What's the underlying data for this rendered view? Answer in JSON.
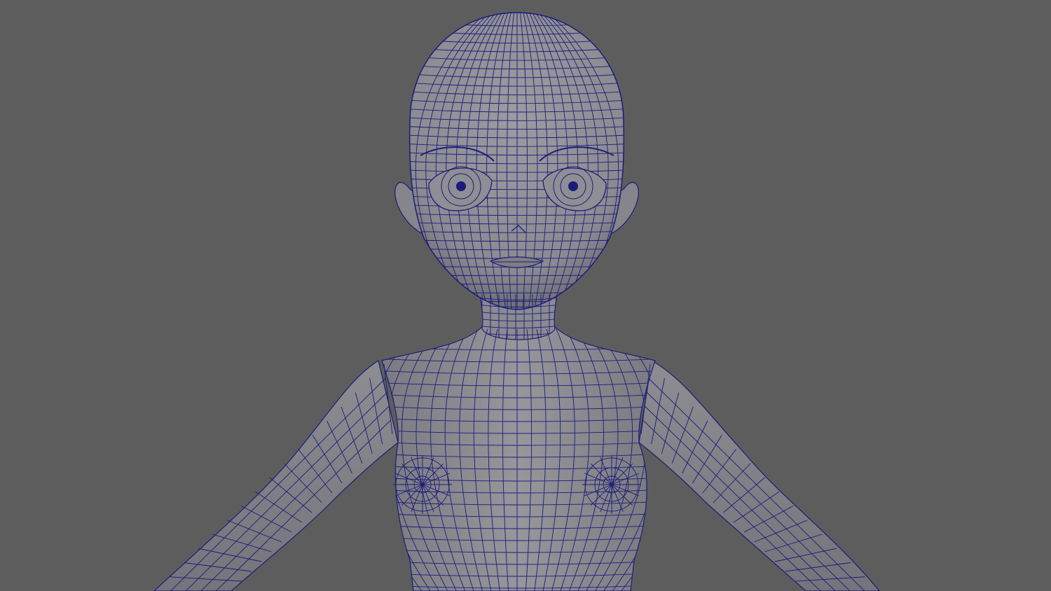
{
  "viewport": {
    "background_color": "#5d5d5d",
    "mesh_fill_color": "#8e8e93",
    "mesh_shade_color": "#6f6f76",
    "wireframe_color": "#1c1c7a",
    "display_mode": "wireframe-on-shaded"
  },
  "model": {
    "parts": [
      "head",
      "ears",
      "eyes",
      "nose",
      "mouth",
      "neck",
      "torso",
      "left-arm",
      "right-arm"
    ]
  }
}
